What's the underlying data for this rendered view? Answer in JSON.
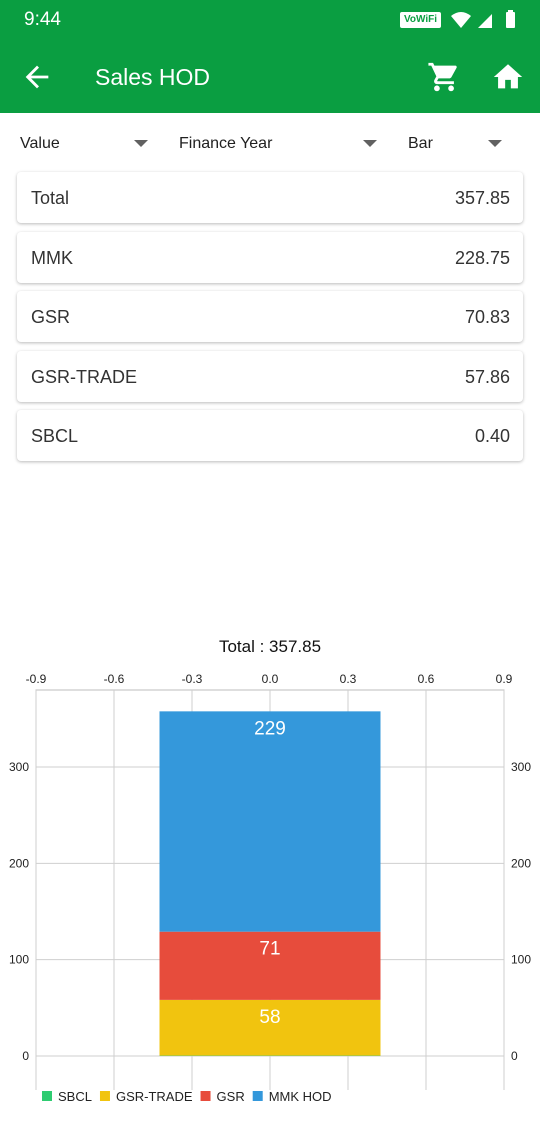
{
  "status_bar": {
    "time": "9:44",
    "wifi_badge": "VoWiFi"
  },
  "app_bar": {
    "title": "Sales HOD",
    "back_icon": "arrow-back-icon",
    "cart_icon": "shopping-cart-icon",
    "home_icon": "home-icon"
  },
  "filters": [
    {
      "label": "Value"
    },
    {
      "label": "Finance Year"
    },
    {
      "label": "Bar"
    }
  ],
  "summary_rows": [
    {
      "label": "Total",
      "value": "357.85"
    },
    {
      "label": "MMK",
      "value": "228.75"
    },
    {
      "label": "GSR",
      "value": "70.83"
    },
    {
      "label": "GSR-TRADE",
      "value": "57.86"
    },
    {
      "label": "SBCL",
      "value": "0.40"
    }
  ],
  "colors": {
    "brand": "#0a9e41",
    "sbcl": "#2ecc71",
    "gsr_trade": "#f1c40f",
    "gsr": "#e74c3c",
    "mmk_hod": "#3498db"
  },
  "chart_data": {
    "type": "bar",
    "stacked": true,
    "title": "Total : 357.85",
    "categories": [
      ""
    ],
    "x_ticks": [
      "-0.9",
      "-0.6",
      "-0.3",
      "0.0",
      "0.3",
      "0.6",
      "0.9"
    ],
    "xlim": [
      -0.9,
      0.9
    ],
    "y_ticks": [
      "0",
      "100",
      "200",
      "300"
    ],
    "ylim": [
      0,
      380
    ],
    "grid": true,
    "legend": "bottom-left",
    "series": [
      {
        "name": "SBCL",
        "values": [
          0.4
        ],
        "label": "",
        "color": "#2ecc71"
      },
      {
        "name": "GSR-TRADE",
        "values": [
          57.86
        ],
        "label": "58",
        "color": "#f1c40f"
      },
      {
        "name": "GSR",
        "values": [
          70.83
        ],
        "label": "71",
        "color": "#e74c3c"
      },
      {
        "name": "MMK  HOD",
        "values": [
          228.75
        ],
        "label": "229",
        "color": "#3498db"
      }
    ]
  }
}
